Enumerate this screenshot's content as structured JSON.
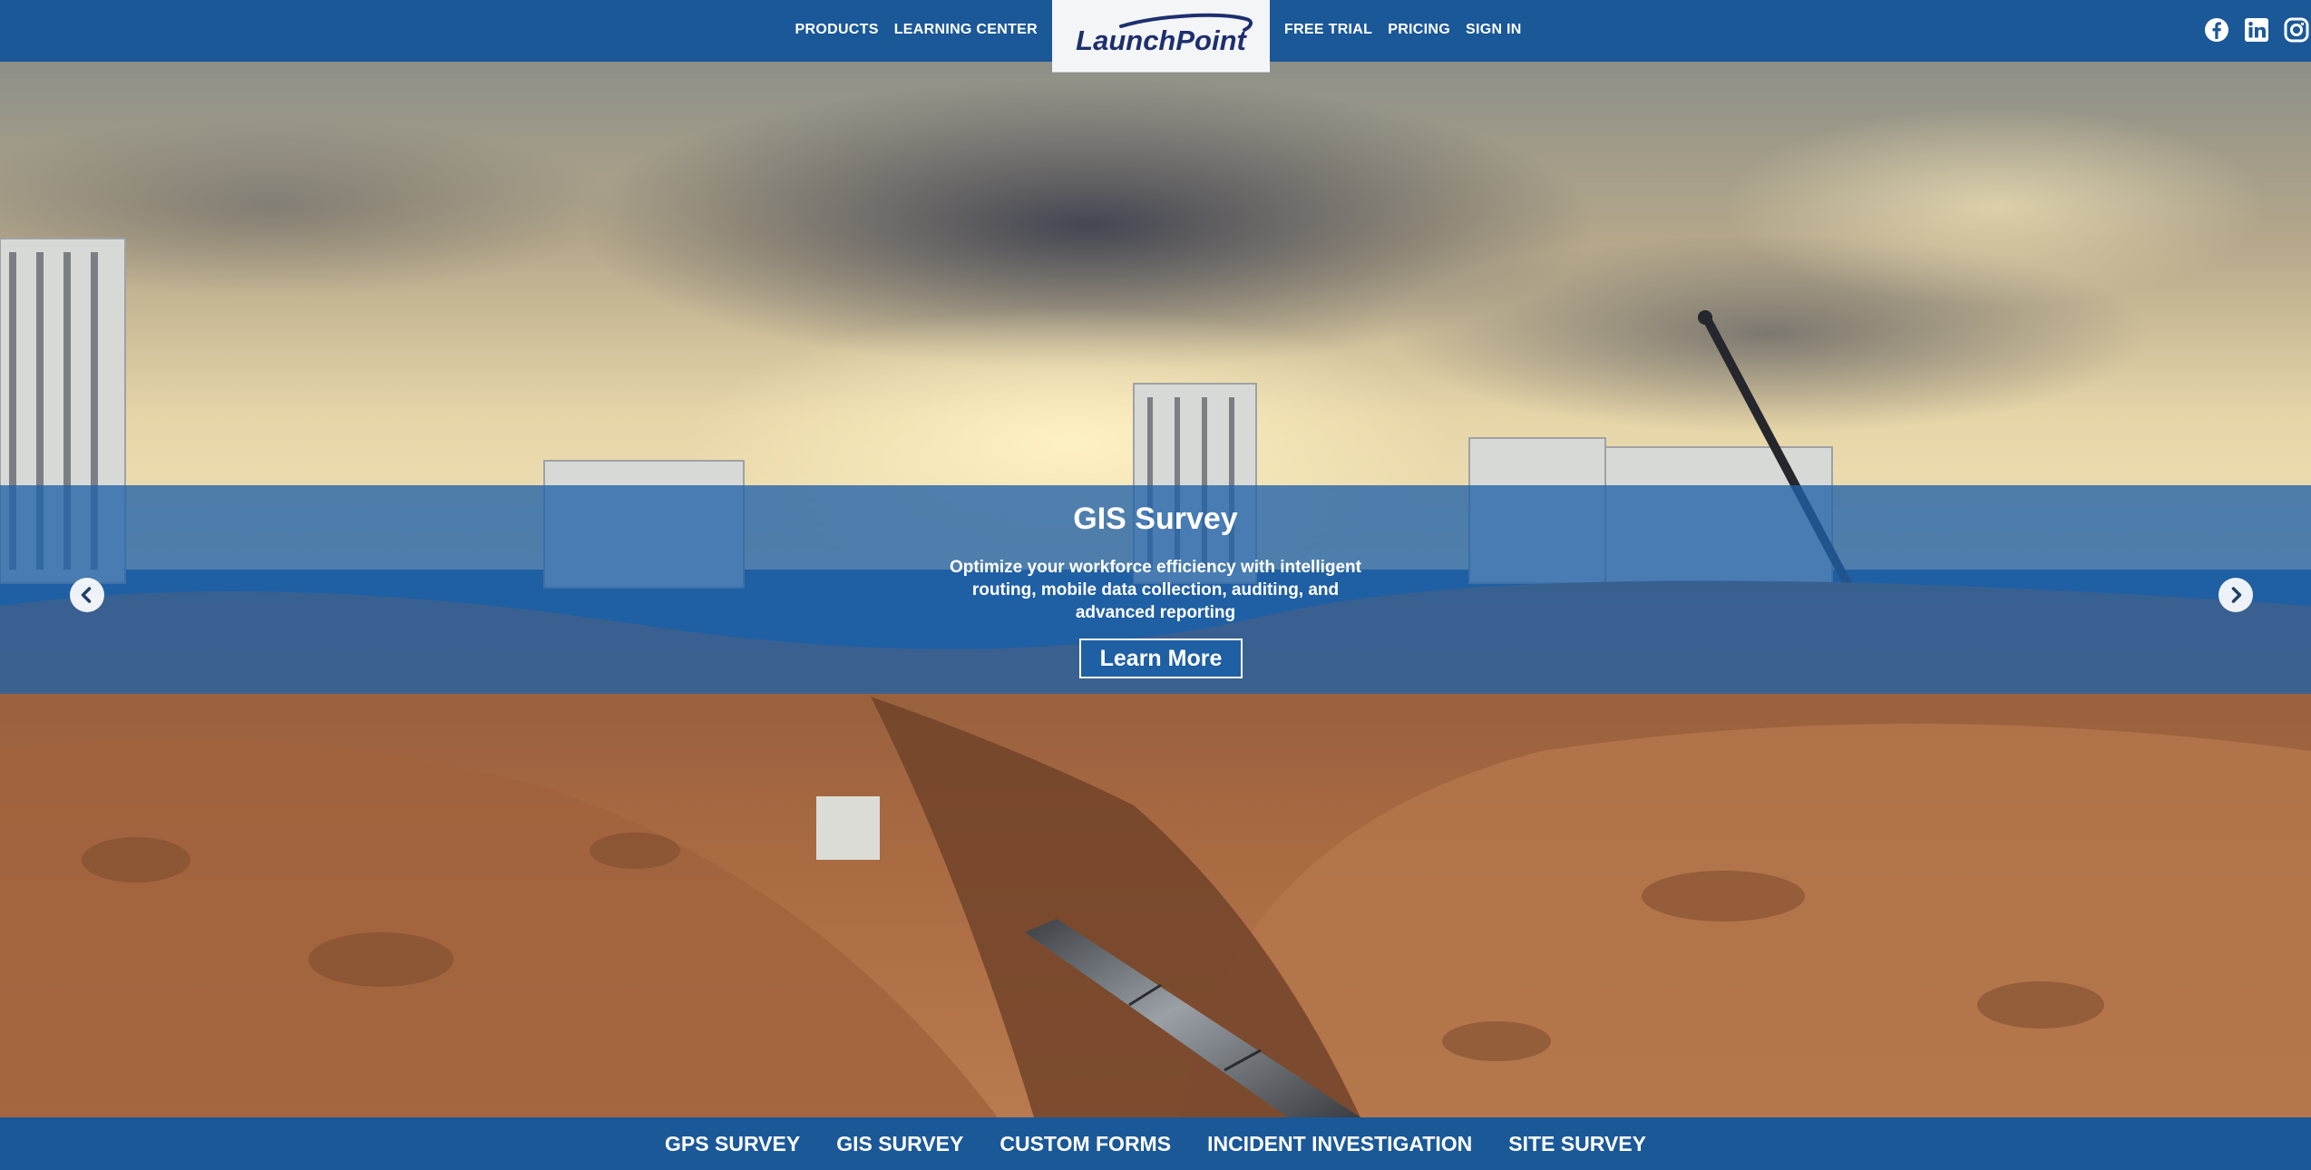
{
  "nav": {
    "left_links": [
      "PRODUCTS",
      "LEARNING CENTER"
    ],
    "right_links": [
      "FREE TRIAL",
      "PRICING",
      "SIGN IN"
    ],
    "logo_text": "LaunchPoint",
    "social_icons": [
      "facebook-icon",
      "linkedin-icon",
      "instagram-icon"
    ]
  },
  "hero": {
    "title": "GIS Survey",
    "description": "Optimize your workforce efficiency with intelligent routing, mobile data collection, auditing, and advanced reporting",
    "cta_label": "Learn More",
    "prev_icon": "chevron-left-icon",
    "next_icon": "chevron-right-icon"
  },
  "bottom_tabs": [
    "GPS SURVEY",
    "GIS SURVEY",
    "CUSTOM FORMS",
    "INCIDENT INVESTIGATION",
    "SITE SURVEY"
  ],
  "colors": {
    "brand_blue": "#1b5898",
    "logo_navy": "#1e2f6e",
    "band_blue": "#2062a8"
  }
}
